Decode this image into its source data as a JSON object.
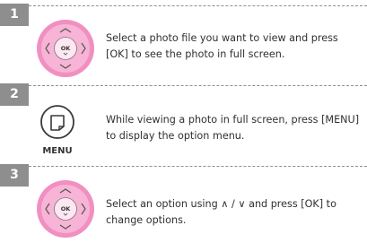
{
  "steps": [
    {
      "number": "1",
      "icon": "dpad-ok-icon",
      "text": "Select a photo file you want to view and press [OK] to see the photo in full screen."
    },
    {
      "number": "2",
      "icon": "menu-button-icon",
      "icon_label": "MENU",
      "text": "While viewing a photo in full screen, press [MENU] to display the option menu."
    },
    {
      "number": "3",
      "icon": "dpad-ok-icon",
      "text": "Select an option using ∧ / ∨ and press [OK] to change options."
    }
  ],
  "colors": {
    "badge": "#8e8e8e",
    "dpad_outer": "#f08fc0",
    "dpad_inner": "#f7b4d6",
    "dpad_center": "#fbe3ef"
  },
  "dpad_center_label": "OK"
}
